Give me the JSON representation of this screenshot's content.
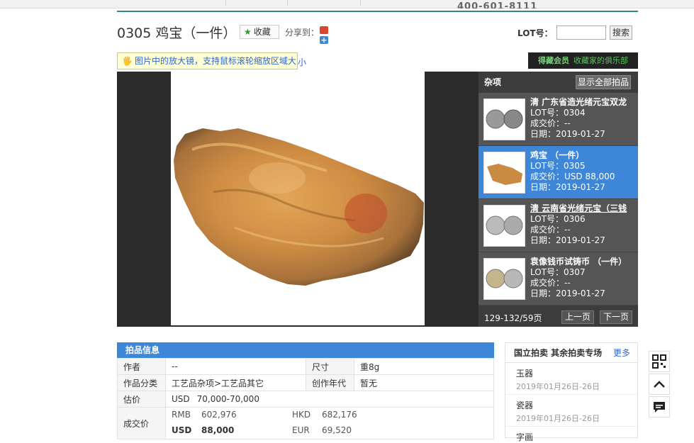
{
  "header": {
    "phone": "400-601-8111"
  },
  "lot": {
    "title": "0305 鸡宝（一件）",
    "favorite_label": "收藏",
    "share_label": "分享到：",
    "plus_icon_text": "+",
    "lot_label": "LOT号：",
    "search_label": "搜索",
    "tip": "图片中的放大镜，支持鼠标滚轮缩放区域大",
    "tip_tail": "小",
    "club_name": "得藏会员",
    "club_slogan": "收藏家的俱乐部"
  },
  "sidebar": {
    "category": "杂项",
    "show_all": "显示全部拍品",
    "items": [
      {
        "name": "清 广东省造光绪元宝双龙",
        "lot": "LOT号：0304",
        "price": "成交价：--",
        "date": "日期：2019-01-27",
        "thumb": "coins"
      },
      {
        "name": "鸡宝 （一件）",
        "lot": "LOT号：0305",
        "price": "成交价：USD 88,000",
        "date": "日期：2019-01-27",
        "thumb": "stone"
      },
      {
        "name": "清 云南省光绪元宝（三钱",
        "lot": "LOT号：0306",
        "price": "成交价：--",
        "date": "日期：2019-01-27",
        "thumb": "coins"
      },
      {
        "name": "袁像钱币试铸币 （一件）",
        "lot": "LOT号：0307",
        "price": "成交价：--",
        "date": "日期：2019-01-27",
        "thumb": "coins"
      }
    ],
    "pager_text": "129-132/59页",
    "prev": "上一页",
    "next": "下一页"
  },
  "info": {
    "header": "拍品信息",
    "author_label": "作者",
    "author_value": "--",
    "size_label": "尺寸",
    "size_value": "重8g",
    "category_label": "作品分类",
    "category_value": "工艺品杂项>工艺品其它",
    "year_label": "创作年代",
    "year_value": "暂无",
    "estimate_label": "估价",
    "estimate_currency": "USD",
    "estimate_value": "70,000-70,000",
    "deal_label": "成交价",
    "rmb_cur": "RMB",
    "rmb_val": "602,976",
    "hkd_cur": "HKD",
    "hkd_val": "682,176",
    "usd_cur": "USD",
    "usd_val": "88,000",
    "eur_cur": "EUR",
    "eur_val": "69,520"
  },
  "other_sales": {
    "title": "国立拍卖 其余拍卖专场",
    "more": "更多",
    "items": [
      {
        "name": "玉器",
        "date": "2019年01月26日-26日"
      },
      {
        "name": "瓷器",
        "date": "2019年01月26日-26日"
      },
      {
        "name": "字画",
        "date": ""
      }
    ]
  },
  "colors": {
    "accent": "#3d86d8",
    "price_red": "#d0282b",
    "club_green": "#5ec25e"
  }
}
